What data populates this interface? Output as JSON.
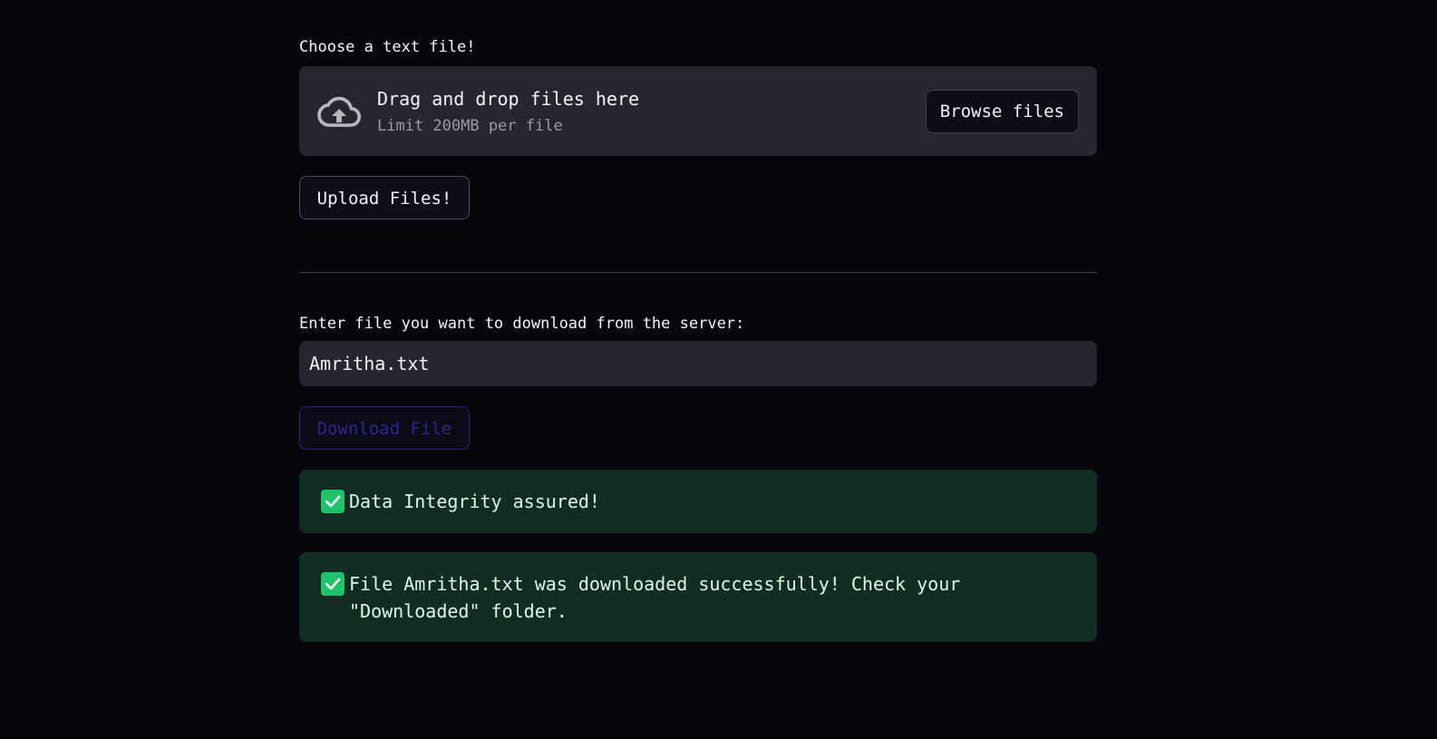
{
  "upload": {
    "label": "Choose a text file!",
    "dropzone_title": "Drag and drop files here",
    "dropzone_limit": "Limit 200MB per file",
    "browse_label": "Browse files",
    "upload_button_label": "Upload Files!"
  },
  "download": {
    "label": "Enter file you want to download from the server:",
    "input_value": "Amritha.txt",
    "download_button_label": "Download File",
    "download_button_disabled": true
  },
  "alerts": [
    {
      "text": "Data Integrity assured!"
    },
    {
      "text": "File Amritha.txt was downloaded successfully! Check your \"Downloaded\" folder."
    }
  ],
  "colors": {
    "background": "#07060d",
    "surface": "#26262f",
    "success_bg": "#112d21",
    "success_icon": "#20c26a",
    "disabled_accent": "#2b2693"
  },
  "icons": {
    "dropzone": "cloud-upload-icon",
    "alert": "check-icon"
  }
}
